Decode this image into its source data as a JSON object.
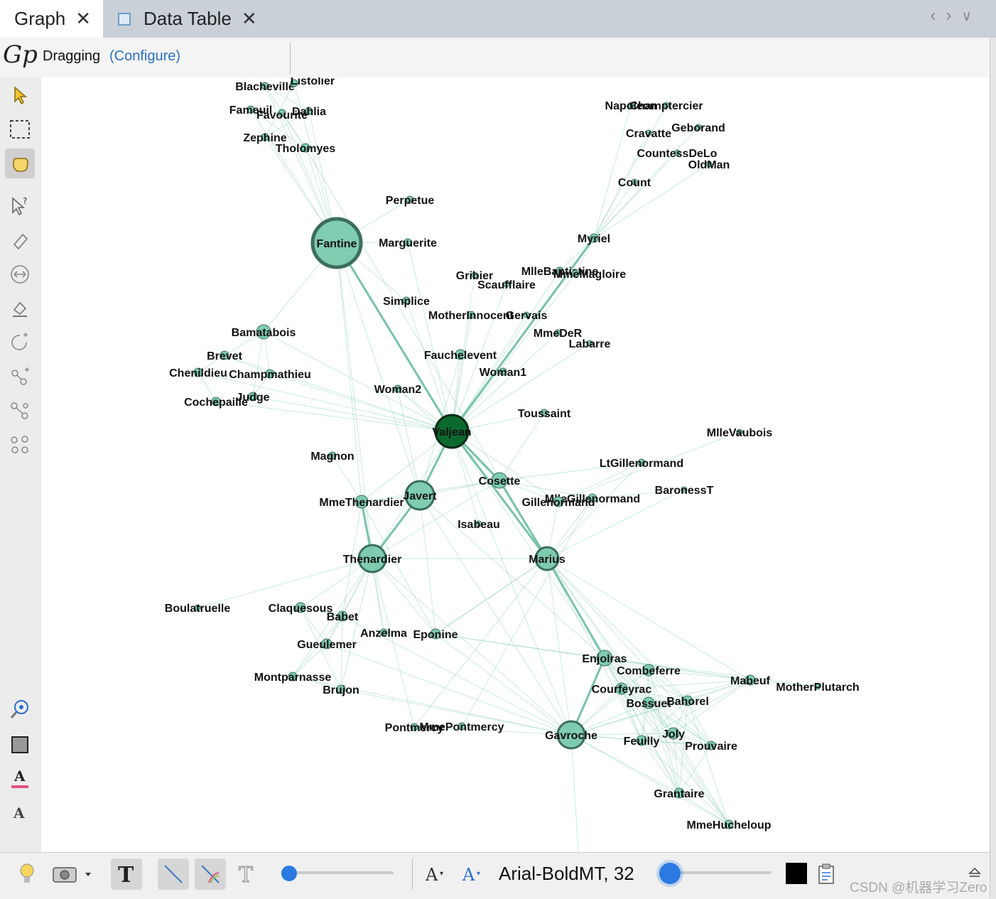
{
  "tabs": [
    {
      "label": "Graph",
      "active": true
    },
    {
      "label": "Data Table",
      "active": false
    }
  ],
  "tab_close": "✕",
  "toolbar": {
    "mode_label": "Dragging",
    "configure_label": "(Configure)"
  },
  "bottom": {
    "font_label": "Arial-BoldMT, 32",
    "watermark": "CSDN @机器学习Zero"
  },
  "colors": {
    "node_fill": "#7fccb1",
    "node_stroke": "#3c6e60",
    "edge": "#7fccb1",
    "valjean_fill": "#0a6a2e",
    "accent": "#2a7ae2"
  },
  "graph": {
    "nodes": [
      {
        "id": "Fantine",
        "label": "Fantine",
        "r": 34,
        "big": true
      },
      {
        "id": "Valjean",
        "label": "Valjean",
        "r": 23,
        "dark": true
      },
      {
        "id": "Javert",
        "label": "Javert",
        "r": 20
      },
      {
        "id": "Thenardier",
        "label": "Thenardier",
        "r": 19
      },
      {
        "id": "Marius",
        "label": "Marius",
        "r": 16
      },
      {
        "id": "Gavroche",
        "label": "Gavroche",
        "r": 19
      },
      {
        "id": "Cosette",
        "label": "Cosette",
        "r": 11
      },
      {
        "id": "Enjolras",
        "label": "Enjolras",
        "r": 11
      },
      {
        "id": "Bamatabois",
        "label": "Bamatabois",
        "r": 10
      },
      {
        "id": "MmeThenardier",
        "label": "MmeThenardier",
        "r": 9
      },
      {
        "id": "Blacheville",
        "label": "Blacheville",
        "r": 5
      },
      {
        "id": "Listolier",
        "label": "Listolier",
        "r": 5
      },
      {
        "id": "Fameuil",
        "label": "Fameuil",
        "r": 5
      },
      {
        "id": "Favourite",
        "label": "Favourite",
        "r": 5
      },
      {
        "id": "Dahlia",
        "label": "Dahlia",
        "r": 5
      },
      {
        "id": "Zephine",
        "label": "Zephine",
        "r": 5
      },
      {
        "id": "Tholomyes",
        "label": "Tholomyes",
        "r": 6
      },
      {
        "id": "Napoleon",
        "label": "Napoleon",
        "r": 4
      },
      {
        "id": "Champtercier",
        "label": "Champtercier",
        "r": 4
      },
      {
        "id": "Cravatte",
        "label": "Cravatte",
        "r": 4
      },
      {
        "id": "Geborand",
        "label": "Geborand",
        "r": 4
      },
      {
        "id": "CountessDeLo",
        "label": "CountessDeLo",
        "r": 4
      },
      {
        "id": "OldMan",
        "label": "OldMan",
        "r": 4
      },
      {
        "id": "Count",
        "label": "Count",
        "r": 4
      },
      {
        "id": "Perpetue",
        "label": "Perpetue",
        "r": 5
      },
      {
        "id": "Marguerite",
        "label": "Marguerite",
        "r": 5
      },
      {
        "id": "Myriel",
        "label": "Myriel",
        "r": 6
      },
      {
        "id": "Gribier",
        "label": "Gribier",
        "r": 4
      },
      {
        "id": "MlleBaptistine",
        "label": "MlleBaptistine",
        "r": 5
      },
      {
        "id": "MmeMagloire",
        "label": "MmeMagloire",
        "r": 5
      },
      {
        "id": "Scaufflaire",
        "label": "Scaufflaire",
        "r": 4
      },
      {
        "id": "Simplice",
        "label": "Simplice",
        "r": 5
      },
      {
        "id": "MotherInnocent",
        "label": "MotherInnocent",
        "r": 5
      },
      {
        "id": "Gervais",
        "label": "Gervais",
        "r": 4
      },
      {
        "id": "MmeDeR",
        "label": "MmeDeR",
        "r": 4
      },
      {
        "id": "Labarre",
        "label": "Labarre",
        "r": 4
      },
      {
        "id": "Fauchelevent",
        "label": "Fauchelevent",
        "r": 7
      },
      {
        "id": "Woman1",
        "label": "Woman1",
        "r": 5
      },
      {
        "id": "Brevet",
        "label": "Brevet",
        "r": 6
      },
      {
        "id": "Chenildieu",
        "label": "Chenildieu",
        "r": 6
      },
      {
        "id": "Champmathieu",
        "label": "Champmathieu",
        "r": 6
      },
      {
        "id": "Cochepaille",
        "label": "Cochepaille",
        "r": 6
      },
      {
        "id": "Judge",
        "label": "Judge",
        "r": 6
      },
      {
        "id": "Woman2",
        "label": "Woman2",
        "r": 5
      },
      {
        "id": "Toussaint",
        "label": "Toussaint",
        "r": 5
      },
      {
        "id": "MlleVaubois",
        "label": "MlleVaubois",
        "r": 4
      },
      {
        "id": "Magnon",
        "label": "Magnon",
        "r": 5
      },
      {
        "id": "LtGillenormand",
        "label": "LtGillenormand",
        "r": 5
      },
      {
        "id": "BaronessT",
        "label": "BaronessT",
        "r": 4
      },
      {
        "id": "MlleGillenormand",
        "label": "MlleGillenormand",
        "r": 6
      },
      {
        "id": "Gillenormand",
        "label": "Gillenormand",
        "r": 7
      },
      {
        "id": "Isabeau",
        "label": "Isabeau",
        "r": 4
      },
      {
        "id": "Boulatruelle",
        "label": "Boulatruelle",
        "r": 4
      },
      {
        "id": "Claquesous",
        "label": "Claquesous",
        "r": 7
      },
      {
        "id": "Babet",
        "label": "Babet",
        "r": 7
      },
      {
        "id": "Anzelma",
        "label": "Anzelma",
        "r": 5
      },
      {
        "id": "Eponine",
        "label": "Eponine",
        "r": 7
      },
      {
        "id": "Gueulemer",
        "label": "Gueulemer",
        "r": 7
      },
      {
        "id": "Montparnasse",
        "label": "Montparnasse",
        "r": 6
      },
      {
        "id": "Brujon",
        "label": "Brujon",
        "r": 6
      },
      {
        "id": "Combeferre",
        "label": "Combeferre",
        "r": 8
      },
      {
        "id": "Mabeuf",
        "label": "Mabeuf",
        "r": 7
      },
      {
        "id": "MotherPlutarch",
        "label": "MotherPlutarch",
        "r": 4
      },
      {
        "id": "Courfeyrac",
        "label": "Courfeyrac",
        "r": 8
      },
      {
        "id": "Bossuet",
        "label": "Bossuet",
        "r": 8
      },
      {
        "id": "Bahorel",
        "label": "Bahorel",
        "r": 7
      },
      {
        "id": "Pontmercy",
        "label": "Pontmercy",
        "r": 5
      },
      {
        "id": "MmePontmercy",
        "label": "MmePontmercy",
        "r": 5
      },
      {
        "id": "Joly",
        "label": "Joly",
        "r": 8
      },
      {
        "id": "Feuilly",
        "label": "Feuilly",
        "r": 7
      },
      {
        "id": "Prouvaire",
        "label": "Prouvaire",
        "r": 6
      },
      {
        "id": "Grantaire",
        "label": "Grantaire",
        "r": 7
      },
      {
        "id": "MmeHucheloup",
        "label": "MmeHucheloup",
        "r": 6
      }
    ],
    "edges": [
      [
        "Fantine",
        "Valjean"
      ],
      [
        "Fantine",
        "Javert"
      ],
      [
        "Fantine",
        "Blacheville"
      ],
      [
        "Fantine",
        "Listolier"
      ],
      [
        "Fantine",
        "Fameuil"
      ],
      [
        "Fantine",
        "Favourite"
      ],
      [
        "Fantine",
        "Dahlia"
      ],
      [
        "Fantine",
        "Zephine"
      ],
      [
        "Fantine",
        "Tholomyes"
      ],
      [
        "Fantine",
        "Marguerite"
      ],
      [
        "Fantine",
        "Bamatabois"
      ],
      [
        "Fantine",
        "Thenardier"
      ],
      [
        "Fantine",
        "Perpetue"
      ],
      [
        "Fantine",
        "Simplice"
      ],
      [
        "Fantine",
        "MmeThenardier"
      ],
      [
        "Blacheville",
        "Listolier"
      ],
      [
        "Fameuil",
        "Favourite"
      ],
      [
        "Dahlia",
        "Zephine"
      ],
      [
        "Tholomyes",
        "Favourite"
      ],
      [
        "Tholomyes",
        "Blacheville"
      ],
      [
        "Zephine",
        "Listolier"
      ],
      [
        "Fameuil",
        "Tholomyes"
      ],
      [
        "Dahlia",
        "Blacheville"
      ],
      [
        "Valjean",
        "Myriel"
      ],
      [
        "Valjean",
        "MlleBaptistine"
      ],
      [
        "Valjean",
        "MmeMagloire"
      ],
      [
        "Valjean",
        "Labarre"
      ],
      [
        "Valjean",
        "Marguerite"
      ],
      [
        "Valjean",
        "MmeDeR"
      ],
      [
        "Valjean",
        "Isabeau"
      ],
      [
        "Valjean",
        "Gervais"
      ],
      [
        "Valjean",
        "Fauchelevent"
      ],
      [
        "Valjean",
        "Bamatabois"
      ],
      [
        "Valjean",
        "Simplice"
      ],
      [
        "Valjean",
        "Scaufflaire"
      ],
      [
        "Valjean",
        "Woman1"
      ],
      [
        "Valjean",
        "Judge"
      ],
      [
        "Valjean",
        "Champmathieu"
      ],
      [
        "Valjean",
        "Brevet"
      ],
      [
        "Valjean",
        "Chenildieu"
      ],
      [
        "Valjean",
        "Cochepaille"
      ],
      [
        "Valjean",
        "Woman2"
      ],
      [
        "Valjean",
        "Toussaint"
      ],
      [
        "Valjean",
        "Cosette"
      ],
      [
        "Valjean",
        "Marius"
      ],
      [
        "Valjean",
        "Javert"
      ],
      [
        "Valjean",
        "Thenardier"
      ],
      [
        "Valjean",
        "MmeThenardier"
      ],
      [
        "Valjean",
        "Gavroche"
      ],
      [
        "Valjean",
        "Gillenormand"
      ],
      [
        "Valjean",
        "Enjolras"
      ],
      [
        "Valjean",
        "MotherInnocent"
      ],
      [
        "Valjean",
        "Gribier"
      ],
      [
        "Myriel",
        "Napoleon"
      ],
      [
        "Myriel",
        "Count"
      ],
      [
        "Myriel",
        "OldMan"
      ],
      [
        "Myriel",
        "CountessDeLo"
      ],
      [
        "Myriel",
        "Geborand"
      ],
      [
        "Myriel",
        "Champtercier"
      ],
      [
        "Myriel",
        "Cravatte"
      ],
      [
        "Myriel",
        "MlleBaptistine"
      ],
      [
        "Myriel",
        "MmeMagloire"
      ],
      [
        "Bamatabois",
        "Judge"
      ],
      [
        "Bamatabois",
        "Champmathieu"
      ],
      [
        "Bamatabois",
        "Brevet"
      ],
      [
        "Brevet",
        "Chenildieu"
      ],
      [
        "Chenildieu",
        "Cochepaille"
      ],
      [
        "Champmathieu",
        "Judge"
      ],
      [
        "Cochepaille",
        "Judge"
      ],
      [
        "Brevet",
        "Champmathieu"
      ],
      [
        "Javert",
        "Thenardier"
      ],
      [
        "Javert",
        "MmeThenardier"
      ],
      [
        "Javert",
        "Cosette"
      ],
      [
        "Javert",
        "Gavroche"
      ],
      [
        "Javert",
        "Enjolras"
      ],
      [
        "Javert",
        "Eponine"
      ],
      [
        "Javert",
        "Woman2"
      ],
      [
        "Javert",
        "Fauchelevent"
      ],
      [
        "Thenardier",
        "MmeThenardier"
      ],
      [
        "Thenardier",
        "Cosette"
      ],
      [
        "Thenardier",
        "Marius"
      ],
      [
        "Thenardier",
        "Babet"
      ],
      [
        "Thenardier",
        "Gueulemer"
      ],
      [
        "Thenardier",
        "Claquesous"
      ],
      [
        "Thenardier",
        "Montparnasse"
      ],
      [
        "Thenardier",
        "Brujon"
      ],
      [
        "Thenardier",
        "Eponine"
      ],
      [
        "Thenardier",
        "Anzelma"
      ],
      [
        "Thenardier",
        "Boulatruelle"
      ],
      [
        "Thenardier",
        "Gavroche"
      ],
      [
        "Thenardier",
        "Pontmercy"
      ],
      [
        "MmeThenardier",
        "Cosette"
      ],
      [
        "MmeThenardier",
        "Magnon"
      ],
      [
        "MmeThenardier",
        "Babet"
      ],
      [
        "MmeThenardier",
        "Eponine"
      ],
      [
        "MmeThenardier",
        "Anzelma"
      ],
      [
        "Babet",
        "Gueulemer"
      ],
      [
        "Babet",
        "Claquesous"
      ],
      [
        "Babet",
        "Montparnasse"
      ],
      [
        "Babet",
        "Brujon"
      ],
      [
        "Gueulemer",
        "Claquesous"
      ],
      [
        "Gueulemer",
        "Montparnasse"
      ],
      [
        "Claquesous",
        "Brujon"
      ],
      [
        "Montparnasse",
        "Brujon"
      ],
      [
        "Eponine",
        "Marius"
      ],
      [
        "Eponine",
        "Gavroche"
      ],
      [
        "Eponine",
        "Enjolras"
      ],
      [
        "Cosette",
        "Marius"
      ],
      [
        "Cosette",
        "Gillenormand"
      ],
      [
        "Cosette",
        "MlleGillenormand"
      ],
      [
        "Cosette",
        "LtGillenormand"
      ],
      [
        "Cosette",
        "Toussaint"
      ],
      [
        "Cosette",
        "Woman2"
      ],
      [
        "Marius",
        "Gillenormand"
      ],
      [
        "Marius",
        "MlleGillenormand"
      ],
      [
        "Marius",
        "LtGillenormand"
      ],
      [
        "Marius",
        "BaronessT"
      ],
      [
        "Marius",
        "Enjolras"
      ],
      [
        "Marius",
        "Combeferre"
      ],
      [
        "Marius",
        "Courfeyrac"
      ],
      [
        "Marius",
        "Bossuet"
      ],
      [
        "Marius",
        "Bahorel"
      ],
      [
        "Marius",
        "Joly"
      ],
      [
        "Marius",
        "Feuilly"
      ],
      [
        "Marius",
        "Mabeuf"
      ],
      [
        "Marius",
        "Gavroche"
      ],
      [
        "Marius",
        "Pontmercy"
      ],
      [
        "Marius",
        "Tholomyes"
      ],
      [
        "Marius",
        "Eponine"
      ],
      [
        "Gillenormand",
        "MlleGillenormand"
      ],
      [
        "Gillenormand",
        "MlleVaubois"
      ],
      [
        "Gillenormand",
        "BaronessT"
      ],
      [
        "Gillenormand",
        "LtGillenormand"
      ],
      [
        "MlleGillenormand",
        "MmePontmercy"
      ],
      [
        "Pontmercy",
        "MmePontmercy"
      ],
      [
        "Pontmercy",
        "Gavroche"
      ],
      [
        "Gavroche",
        "Enjolras"
      ],
      [
        "Gavroche",
        "Combeferre"
      ],
      [
        "Gavroche",
        "Courfeyrac"
      ],
      [
        "Gavroche",
        "Bossuet"
      ],
      [
        "Gavroche",
        "Bahorel"
      ],
      [
        "Gavroche",
        "Joly"
      ],
      [
        "Gavroche",
        "Feuilly"
      ],
      [
        "Gavroche",
        "Prouvaire"
      ],
      [
        "Gavroche",
        "Grantaire"
      ],
      [
        "Gavroche",
        "Mabeuf"
      ],
      [
        "Gavroche",
        "MmeHucheloup"
      ],
      [
        "Gavroche",
        "Gueulemer"
      ],
      [
        "Gavroche",
        "Babet"
      ],
      [
        "Gavroche",
        "Brujon"
      ],
      [
        "Gavroche",
        "Montparnasse"
      ],
      [
        "Enjolras",
        "Combeferre"
      ],
      [
        "Enjolras",
        "Courfeyrac"
      ],
      [
        "Enjolras",
        "Bossuet"
      ],
      [
        "Enjolras",
        "Bahorel"
      ],
      [
        "Enjolras",
        "Joly"
      ],
      [
        "Enjolras",
        "Feuilly"
      ],
      [
        "Enjolras",
        "Prouvaire"
      ],
      [
        "Enjolras",
        "Grantaire"
      ],
      [
        "Enjolras",
        "Mabeuf"
      ],
      [
        "Enjolras",
        "MotherPlutarch"
      ],
      [
        "Enjolras",
        "MmeHucheloup"
      ],
      [
        "Combeferre",
        "Courfeyrac"
      ],
      [
        "Combeferre",
        "Bossuet"
      ],
      [
        "Combeferre",
        "Bahorel"
      ],
      [
        "Combeferre",
        "Joly"
      ],
      [
        "Combeferre",
        "Feuilly"
      ],
      [
        "Combeferre",
        "Prouvaire"
      ],
      [
        "Combeferre",
        "Grantaire"
      ],
      [
        "Combeferre",
        "Mabeuf"
      ],
      [
        "Courfeyrac",
        "Bossuet"
      ],
      [
        "Courfeyrac",
        "Bahorel"
      ],
      [
        "Courfeyrac",
        "Joly"
      ],
      [
        "Courfeyrac",
        "Feuilly"
      ],
      [
        "Courfeyrac",
        "Prouvaire"
      ],
      [
        "Courfeyrac",
        "Grantaire"
      ],
      [
        "Courfeyrac",
        "Mabeuf"
      ],
      [
        "Courfeyrac",
        "MmeHucheloup"
      ],
      [
        "Bossuet",
        "Bahorel"
      ],
      [
        "Bossuet",
        "Joly"
      ],
      [
        "Bossuet",
        "Feuilly"
      ],
      [
        "Bossuet",
        "Prouvaire"
      ],
      [
        "Bossuet",
        "Grantaire"
      ],
      [
        "Bossuet",
        "Mabeuf"
      ],
      [
        "Bossuet",
        "MmeHucheloup"
      ],
      [
        "Bahorel",
        "Joly"
      ],
      [
        "Bahorel",
        "Feuilly"
      ],
      [
        "Bahorel",
        "Prouvaire"
      ],
      [
        "Bahorel",
        "Grantaire"
      ],
      [
        "Bahorel",
        "Mabeuf"
      ],
      [
        "Bahorel",
        "MmeHucheloup"
      ],
      [
        "Joly",
        "Feuilly"
      ],
      [
        "Joly",
        "Prouvaire"
      ],
      [
        "Joly",
        "Grantaire"
      ],
      [
        "Joly",
        "Mabeuf"
      ],
      [
        "Joly",
        "MmeHucheloup"
      ],
      [
        "Feuilly",
        "Prouvaire"
      ],
      [
        "Feuilly",
        "Grantaire"
      ],
      [
        "Feuilly",
        "Mabeuf"
      ],
      [
        "Feuilly",
        "MmeHucheloup"
      ],
      [
        "Prouvaire",
        "Grantaire"
      ],
      [
        "Grantaire",
        "MmeHucheloup"
      ],
      [
        "Mabeuf",
        "MotherPlutarch"
      ],
      [
        "Mabeuf",
        "Eponine"
      ]
    ]
  }
}
